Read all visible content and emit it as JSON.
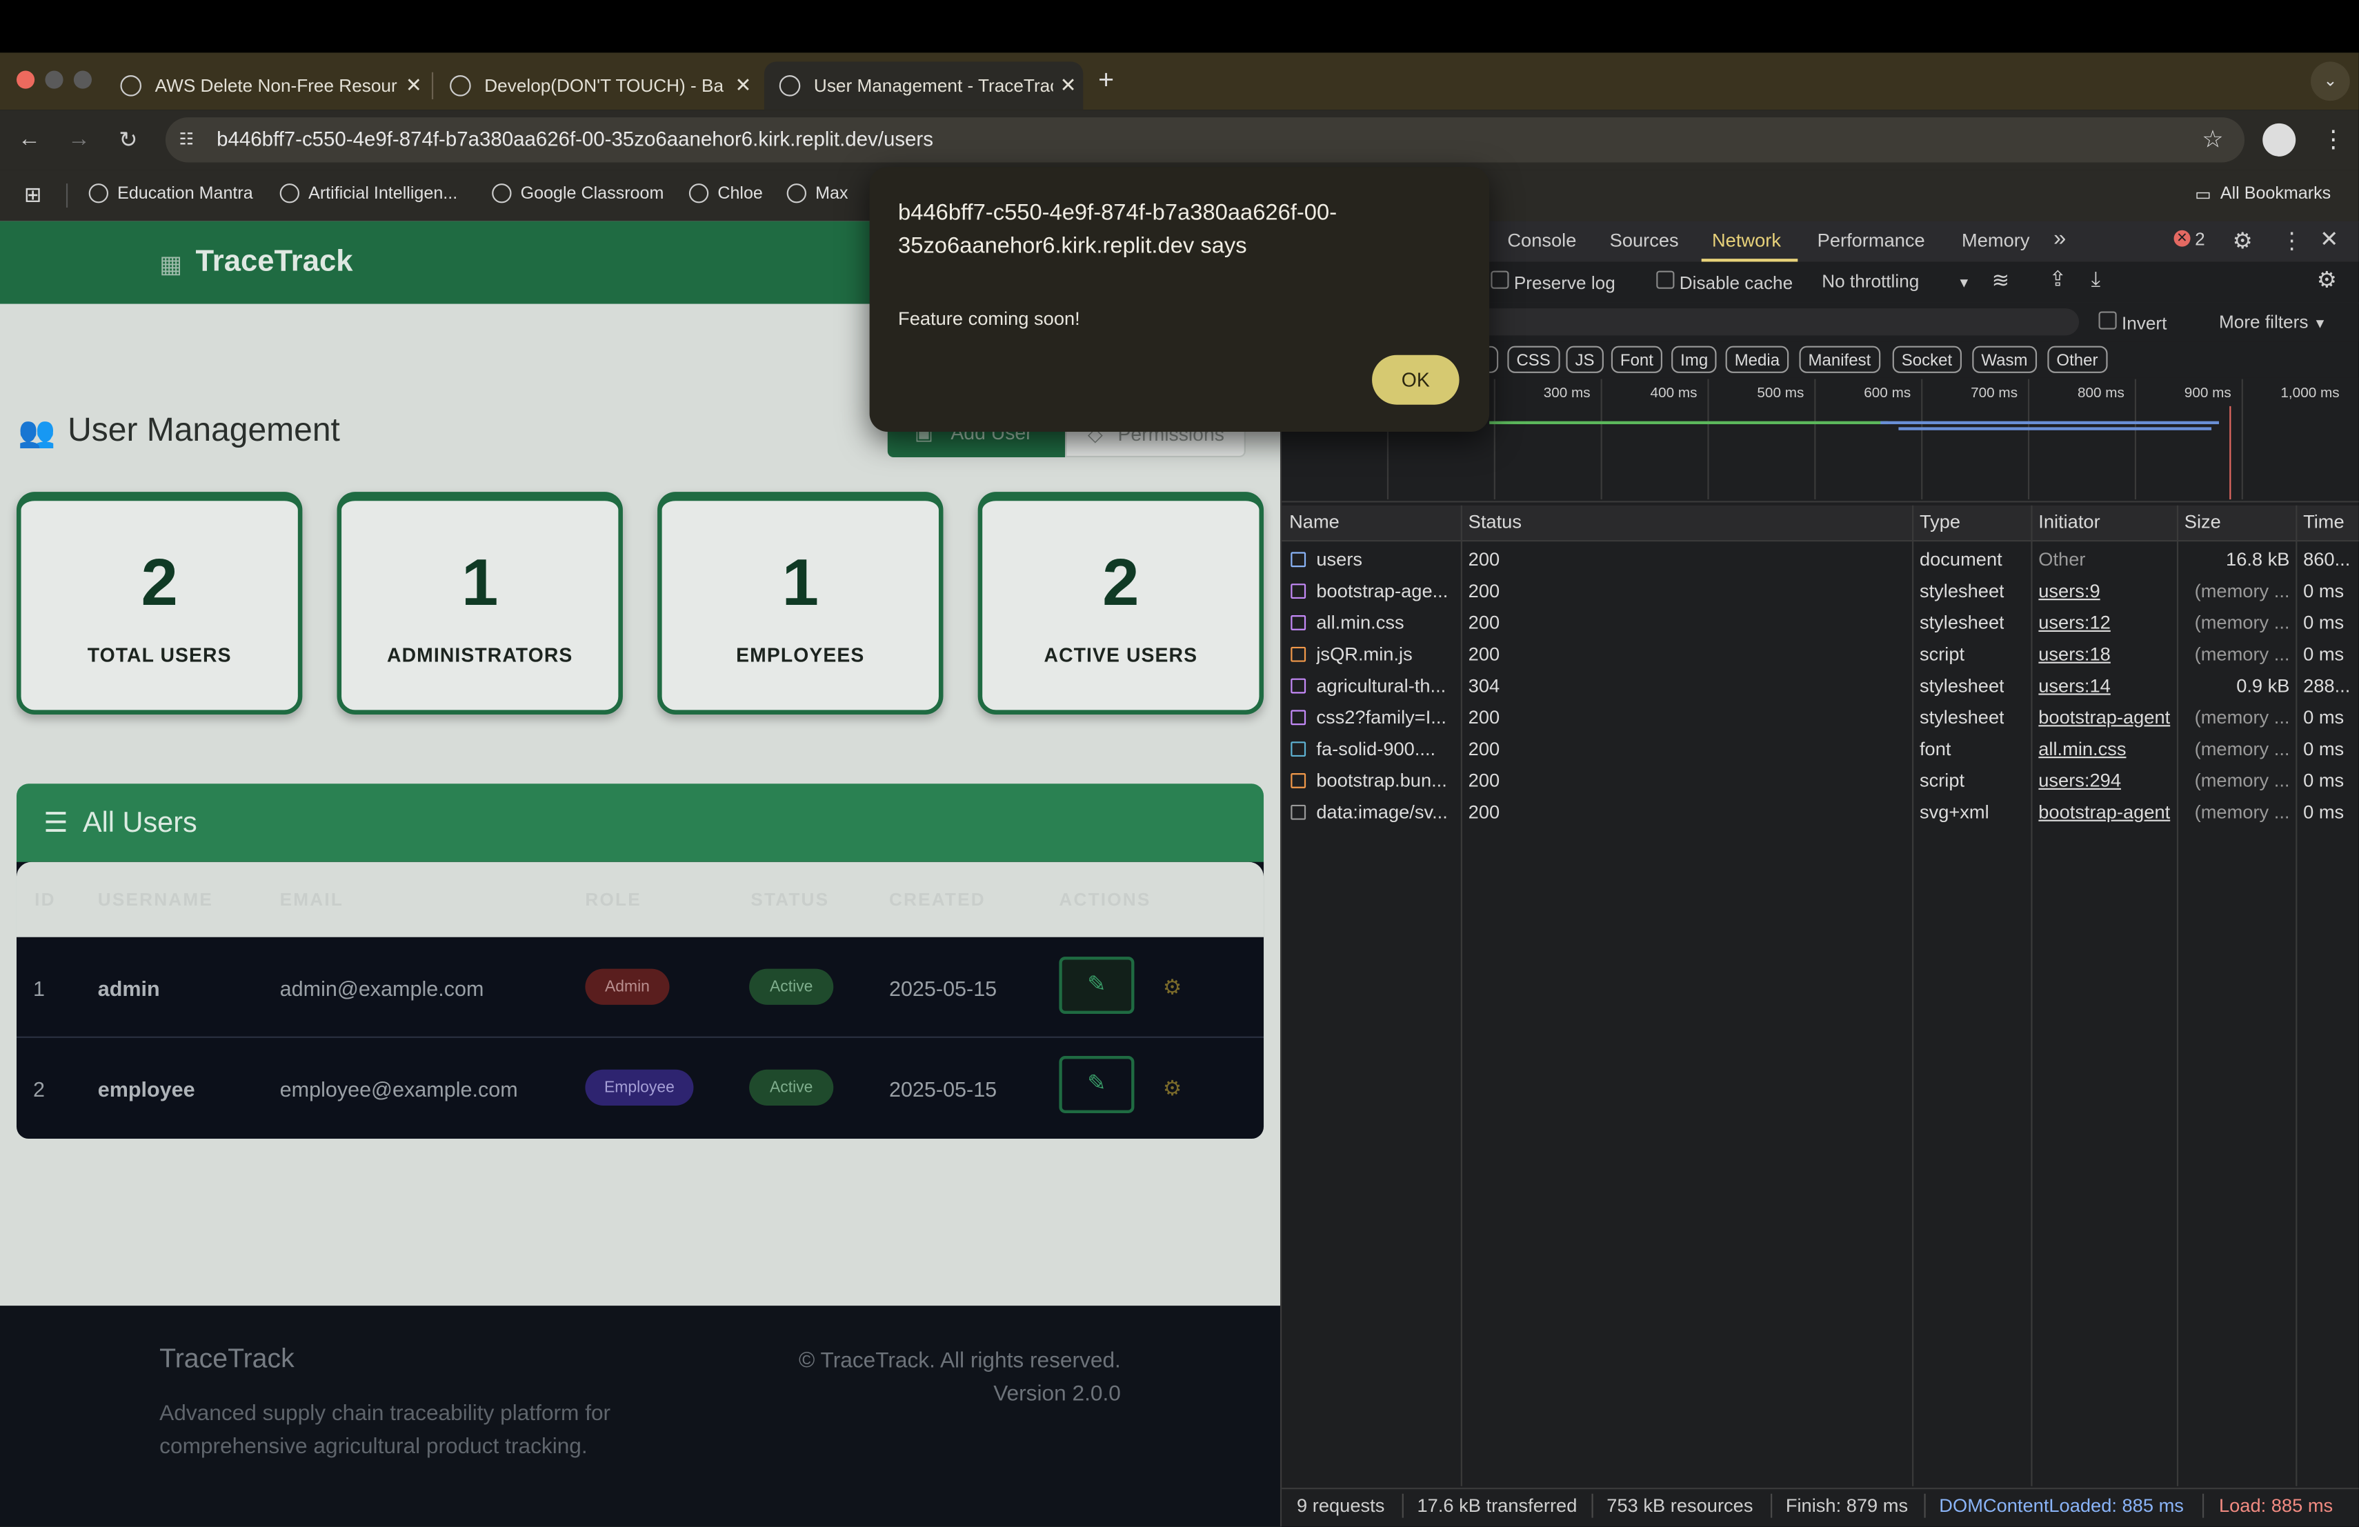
{
  "browser": {
    "tabs": [
      {
        "title": "AWS Delete Non-Free Resour",
        "close": "✕"
      },
      {
        "title": "Develop(DON'T TOUCH) - Ba",
        "close": "✕"
      },
      {
        "title": "User Management - TraceTrac",
        "close": "✕"
      }
    ],
    "new_tab": "+",
    "url": "b446bff7-c550-4e9f-874f-b7a380aa626f-00-35zo6aanehor6.kirk.replit.dev/users",
    "bookmarks": [
      "Education Mantra",
      "Artificial Intelligen...",
      "Google Classroom",
      "Chloe",
      "Max"
    ],
    "all_bookmarks": "All Bookmarks"
  },
  "app": {
    "brand": "TraceTrack",
    "page_title": "User Management",
    "add_user": "Add User",
    "permissions": "Permissions",
    "stats": [
      {
        "value": "2",
        "label": "TOTAL USERS"
      },
      {
        "value": "1",
        "label": "ADMINISTRATORS"
      },
      {
        "value": "1",
        "label": "EMPLOYEES"
      },
      {
        "value": "2",
        "label": "ACTIVE USERS"
      }
    ],
    "all_users_title": "All Users",
    "columns": [
      "ID",
      "USERNAME",
      "EMAIL",
      "ROLE",
      "STATUS",
      "CREATED",
      "ACTIONS"
    ],
    "users": [
      {
        "id": "1",
        "username": "admin",
        "email": "admin@example.com",
        "role": "Admin",
        "status": "Active",
        "created": "2025-05-15"
      },
      {
        "id": "2",
        "username": "employee",
        "email": "employee@example.com",
        "role": "Employee",
        "status": "Active",
        "created": "2025-05-15"
      }
    ],
    "footer": {
      "brand": "TraceTrack",
      "tagline": "Advanced supply chain traceability platform for comprehensive agricultural product tracking.",
      "copyright": "© TraceTrack. All rights reserved.",
      "version": "Version 2.0.0"
    }
  },
  "dialog": {
    "heading": "b446bff7-c550-4e9f-874f-b7a380aa626f-00-35zo6aanehor6.kirk.replit.dev says",
    "message": "Feature coming soon!",
    "ok": "OK"
  },
  "devtools": {
    "tabs": [
      "Console",
      "Sources",
      "Network",
      "Performance",
      "Memory"
    ],
    "more": "»",
    "error_count": "2",
    "preserve_log": "Preserve log",
    "disable_cache": "Disable cache",
    "throttling": "No throttling",
    "invert": "Invert",
    "more_filters": "More filters",
    "type_chips": [
      "CSS",
      "JS",
      "Font",
      "Img",
      "Media",
      "Manifest",
      "Socket",
      "Wasm",
      "Other"
    ],
    "timeline_ticks": [
      "300 ms",
      "400 ms",
      "500 ms",
      "600 ms",
      "700 ms",
      "800 ms",
      "900 ms",
      "1,000 ms"
    ],
    "columns": [
      "Name",
      "Status",
      "Type",
      "Initiator",
      "Size",
      "Time"
    ],
    "requests": [
      {
        "name": "users",
        "status": "200",
        "type": "document",
        "initiator": "Other",
        "size": "16.8 kB",
        "time": "860...",
        "icon_color": "#8ab4f8"
      },
      {
        "name": "bootstrap-age...",
        "status": "200",
        "type": "stylesheet",
        "initiator": "users:9",
        "size": "(memory ...",
        "time": "0 ms",
        "icon_color": "#c58af9"
      },
      {
        "name": "all.min.css",
        "status": "200",
        "type": "stylesheet",
        "initiator": "users:12",
        "size": "(memory ...",
        "time": "0 ms",
        "icon_color": "#c58af9"
      },
      {
        "name": "jsQR.min.js",
        "status": "200",
        "type": "script",
        "initiator": "users:18",
        "size": "(memory ...",
        "time": "0 ms",
        "icon_color": "#f2994a"
      },
      {
        "name": "agricultural-th...",
        "status": "304",
        "type": "stylesheet",
        "initiator": "users:14",
        "size": "0.9 kB",
        "time": "288...",
        "icon_color": "#c58af9"
      },
      {
        "name": "css2?family=I...",
        "status": "200",
        "type": "stylesheet",
        "initiator": "bootstrap-agent",
        "size": "(memory ...",
        "time": "0 ms",
        "icon_color": "#c58af9"
      },
      {
        "name": "fa-solid-900....",
        "status": "200",
        "type": "font",
        "initiator": "all.min.css",
        "size": "(memory ...",
        "time": "0 ms",
        "icon_color": "#5fb3d4"
      },
      {
        "name": "bootstrap.bun...",
        "status": "200",
        "type": "script",
        "initiator": "users:294",
        "size": "(memory ...",
        "time": "0 ms",
        "icon_color": "#f2994a"
      },
      {
        "name": "data:image/sv...",
        "status": "200",
        "type": "svg+xml",
        "initiator": "bootstrap-agent",
        "size": "(memory ...",
        "time": "0 ms",
        "icon_color": "#9a9a9a"
      }
    ],
    "summary": {
      "requests": "9 requests",
      "transferred": "17.6 kB transferred",
      "resources": "753 kB resources",
      "finish": "Finish: 879 ms",
      "dom": "DOMContentLoaded: 885 ms",
      "load": "Load: 885 ms"
    }
  }
}
